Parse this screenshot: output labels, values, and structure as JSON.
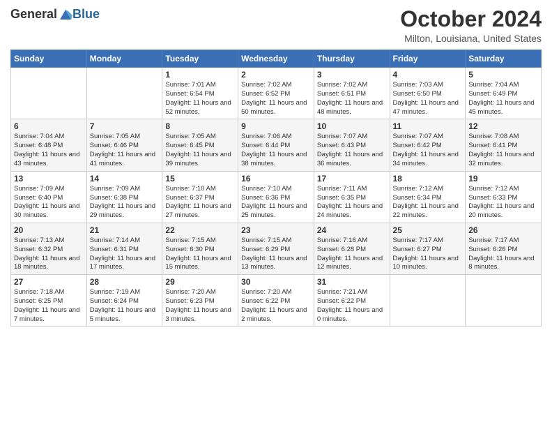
{
  "header": {
    "logo_general": "General",
    "logo_blue": "Blue",
    "month_title": "October 2024",
    "location": "Milton, Louisiana, United States"
  },
  "days_of_week": [
    "Sunday",
    "Monday",
    "Tuesday",
    "Wednesday",
    "Thursday",
    "Friday",
    "Saturday"
  ],
  "weeks": [
    [
      {
        "day": "",
        "content": ""
      },
      {
        "day": "",
        "content": ""
      },
      {
        "day": "1",
        "content": "Sunrise: 7:01 AM\nSunset: 6:54 PM\nDaylight: 11 hours and 52 minutes."
      },
      {
        "day": "2",
        "content": "Sunrise: 7:02 AM\nSunset: 6:52 PM\nDaylight: 11 hours and 50 minutes."
      },
      {
        "day": "3",
        "content": "Sunrise: 7:02 AM\nSunset: 6:51 PM\nDaylight: 11 hours and 48 minutes."
      },
      {
        "day": "4",
        "content": "Sunrise: 7:03 AM\nSunset: 6:50 PM\nDaylight: 11 hours and 47 minutes."
      },
      {
        "day": "5",
        "content": "Sunrise: 7:04 AM\nSunset: 6:49 PM\nDaylight: 11 hours and 45 minutes."
      }
    ],
    [
      {
        "day": "6",
        "content": "Sunrise: 7:04 AM\nSunset: 6:48 PM\nDaylight: 11 hours and 43 minutes."
      },
      {
        "day": "7",
        "content": "Sunrise: 7:05 AM\nSunset: 6:46 PM\nDaylight: 11 hours and 41 minutes."
      },
      {
        "day": "8",
        "content": "Sunrise: 7:05 AM\nSunset: 6:45 PM\nDaylight: 11 hours and 39 minutes."
      },
      {
        "day": "9",
        "content": "Sunrise: 7:06 AM\nSunset: 6:44 PM\nDaylight: 11 hours and 38 minutes."
      },
      {
        "day": "10",
        "content": "Sunrise: 7:07 AM\nSunset: 6:43 PM\nDaylight: 11 hours and 36 minutes."
      },
      {
        "day": "11",
        "content": "Sunrise: 7:07 AM\nSunset: 6:42 PM\nDaylight: 11 hours and 34 minutes."
      },
      {
        "day": "12",
        "content": "Sunrise: 7:08 AM\nSunset: 6:41 PM\nDaylight: 11 hours and 32 minutes."
      }
    ],
    [
      {
        "day": "13",
        "content": "Sunrise: 7:09 AM\nSunset: 6:40 PM\nDaylight: 11 hours and 30 minutes."
      },
      {
        "day": "14",
        "content": "Sunrise: 7:09 AM\nSunset: 6:38 PM\nDaylight: 11 hours and 29 minutes."
      },
      {
        "day": "15",
        "content": "Sunrise: 7:10 AM\nSunset: 6:37 PM\nDaylight: 11 hours and 27 minutes."
      },
      {
        "day": "16",
        "content": "Sunrise: 7:10 AM\nSunset: 6:36 PM\nDaylight: 11 hours and 25 minutes."
      },
      {
        "day": "17",
        "content": "Sunrise: 7:11 AM\nSunset: 6:35 PM\nDaylight: 11 hours and 24 minutes."
      },
      {
        "day": "18",
        "content": "Sunrise: 7:12 AM\nSunset: 6:34 PM\nDaylight: 11 hours and 22 minutes."
      },
      {
        "day": "19",
        "content": "Sunrise: 7:12 AM\nSunset: 6:33 PM\nDaylight: 11 hours and 20 minutes."
      }
    ],
    [
      {
        "day": "20",
        "content": "Sunrise: 7:13 AM\nSunset: 6:32 PM\nDaylight: 11 hours and 18 minutes."
      },
      {
        "day": "21",
        "content": "Sunrise: 7:14 AM\nSunset: 6:31 PM\nDaylight: 11 hours and 17 minutes."
      },
      {
        "day": "22",
        "content": "Sunrise: 7:15 AM\nSunset: 6:30 PM\nDaylight: 11 hours and 15 minutes."
      },
      {
        "day": "23",
        "content": "Sunrise: 7:15 AM\nSunset: 6:29 PM\nDaylight: 11 hours and 13 minutes."
      },
      {
        "day": "24",
        "content": "Sunrise: 7:16 AM\nSunset: 6:28 PM\nDaylight: 11 hours and 12 minutes."
      },
      {
        "day": "25",
        "content": "Sunrise: 7:17 AM\nSunset: 6:27 PM\nDaylight: 11 hours and 10 minutes."
      },
      {
        "day": "26",
        "content": "Sunrise: 7:17 AM\nSunset: 6:26 PM\nDaylight: 11 hours and 8 minutes."
      }
    ],
    [
      {
        "day": "27",
        "content": "Sunrise: 7:18 AM\nSunset: 6:25 PM\nDaylight: 11 hours and 7 minutes."
      },
      {
        "day": "28",
        "content": "Sunrise: 7:19 AM\nSunset: 6:24 PM\nDaylight: 11 hours and 5 minutes."
      },
      {
        "day": "29",
        "content": "Sunrise: 7:20 AM\nSunset: 6:23 PM\nDaylight: 11 hours and 3 minutes."
      },
      {
        "day": "30",
        "content": "Sunrise: 7:20 AM\nSunset: 6:22 PM\nDaylight: 11 hours and 2 minutes."
      },
      {
        "day": "31",
        "content": "Sunrise: 7:21 AM\nSunset: 6:22 PM\nDaylight: 11 hours and 0 minutes."
      },
      {
        "day": "",
        "content": ""
      },
      {
        "day": "",
        "content": ""
      }
    ]
  ]
}
